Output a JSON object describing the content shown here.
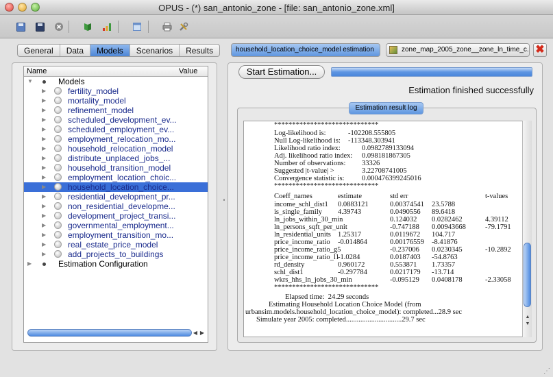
{
  "window": {
    "title": "OPUS - (*) san_antonio_zone - [file: san_antonio_zone.xml]"
  },
  "toolbar": {
    "icons": [
      "new-file-icon",
      "save-icon",
      "close-circle-icon",
      "book-icon",
      "bar-chart-icon",
      "window-icon",
      "printer-icon",
      "tools-icon"
    ]
  },
  "left_tabs": [
    "General",
    "Data",
    "Models",
    "Scenarios",
    "Results"
  ],
  "left_tabs_active": "Models",
  "tree": {
    "columns": {
      "name": "Name",
      "value": "Value"
    },
    "root": "Models",
    "items": [
      "fertility_model",
      "mortality_model",
      "refinement_model",
      "scheduled_development_ev...",
      "scheduled_employment_ev...",
      "employment_relocation_mo...",
      "household_relocation_model",
      "distribute_unplaced_jobs_...",
      "household_transition_model",
      "employment_location_choic...",
      "household_location_choice...",
      "residential_development_pr...",
      "non_residential_developme...",
      "development_project_transi...",
      "governmental_employment...",
      "employment_transition_mo...",
      "real_estate_price_model",
      "add_projects_to_buildings"
    ],
    "selected_index": 10,
    "second_root": "Estimation Configuration"
  },
  "right_tabs": {
    "active": "household_location_choice_model estimation",
    "inactive": "zone_map_2005_zone__zone_ln_time_c..."
  },
  "start_button": "Start Estimation...",
  "progress": 1.0,
  "status": "Estimation finished successfully",
  "log_tab": "Estimation result log",
  "log": {
    "stars_top": "*****************************",
    "summary": [
      {
        "label": "Log-likelihood is:",
        "value": "-102208.555805"
      },
      {
        "label": "Null Log-likelihood is:",
        "value": "-113348.303941"
      },
      {
        "label": "Likelihood ratio index:",
        "value": "0.0982789133094"
      },
      {
        "label": "Adj. likelihood ratio index:",
        "value": "0.098181867305"
      },
      {
        "label": "Number of observations:",
        "value": "33326"
      },
      {
        "label": "Suggested |t-value| >",
        "value": "3.22708741005"
      },
      {
        "label": "Convergence statistic is:",
        "value": "0.000476399245016"
      }
    ],
    "stars_mid": "*****************************",
    "header": {
      "coeff": "Coeff_names",
      "estimate": "estimate",
      "stderr": "std err",
      "tvalues": "t-values"
    },
    "rows": [
      {
        "name": "income_schl_dist1",
        "c1": "0.0883121",
        "c2": "0.00374541",
        "c3": "23.5788",
        "c4": ""
      },
      {
        "name": "is_single_family",
        "c1": "4.39743",
        "c2": "0.0490556",
        "c3": "89.6418",
        "c4": ""
      },
      {
        "name": "ln_jobs_within_30_min",
        "c1": "",
        "c2": "0.124032",
        "c3": "0.0282462",
        "c4": "4.39112"
      },
      {
        "name": "ln_persons_sqft_per_unit",
        "c1": "",
        "c2": "-0.747188",
        "c3": "0.00943668",
        "c4": "-79.1791"
      },
      {
        "name": "ln_residential_units",
        "c1": "1.25317",
        "c2": "0.0119672",
        "c3": "104.717",
        "c4": ""
      },
      {
        "name": "price_income_ratio",
        "c1": "-0.014864",
        "c2": "0.00176559",
        "c3": "-8.41876",
        "c4": ""
      },
      {
        "name": "price_income_ratio_g5",
        "c1": "",
        "c2": "-0.237006",
        "c3": "0.0230345",
        "c4": "-10.2892"
      },
      {
        "name": "price_income_ratio_l1",
        "c1": "-1.0284",
        "c2": "0.0187403",
        "c3": "-54.8763",
        "c4": ""
      },
      {
        "name": "rd_density",
        "c1": "0.960172",
        "c2": "0.553871",
        "c3": "1.73357",
        "c4": ""
      },
      {
        "name": "schl_dist1",
        "c1": "-0.297784",
        "c2": "0.0217179",
        "c3": "-13.714",
        "c4": ""
      },
      {
        "name": "wkrs_hhs_ln_jobs_30_min",
        "c1": "",
        "c2": "-0.095129",
        "c3": "0.0408178",
        "c4": "-2.33058"
      }
    ],
    "stars_bottom": "*****************************",
    "elapsed": "Elapsed time:  24.29 seconds",
    "footer1": "Estimating Household Location Choice Model (from",
    "footer2": "urbansim.models.household_location_choice_model): completed...28.9 sec",
    "footer3": "Simulate year 2005: completed...............................29.7 sec"
  }
}
